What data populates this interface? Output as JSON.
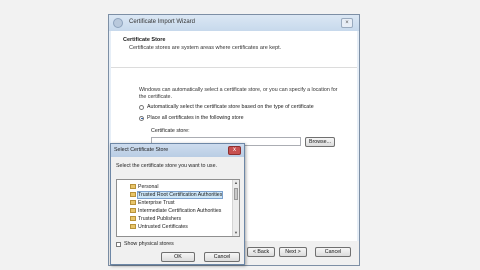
{
  "wizard": {
    "title": "Certificate Import Wizard",
    "heading": "Certificate Store",
    "description": "Certificate stores are system areas where certificates are kept.",
    "paragraph": "Windows can automatically select a certificate store, or you can specify a location for the certificate.",
    "radio_auto": "Automatically select the certificate store based on the type of certificate",
    "radio_manual": "Place all certificates in the following store",
    "store_label": "Certificate store:",
    "store_value": "",
    "browse_label": "Browse...",
    "back_label": "< Back",
    "next_label": "Next >",
    "cancel_label": "Cancel"
  },
  "dialog": {
    "title": "Select Certificate Store",
    "close_glyph": "x",
    "instruction": "Select the certificate store you want to use.",
    "items": [
      {
        "label": "Personal"
      },
      {
        "label": "Trusted Root Certification Authorities",
        "selected": true
      },
      {
        "label": "Enterprise Trust"
      },
      {
        "label": "Intermediate Certification Authorities"
      },
      {
        "label": "Trusted Publishers"
      },
      {
        "label": "Untrusted Certificates"
      }
    ],
    "show_physical_label": "Show physical stores",
    "ok_label": "OK",
    "cancel_label": "Cancel"
  },
  "colors": {
    "selection": "#cde6f7",
    "title_gradient": "#c7d9ec",
    "close_button": "#c75050",
    "folder": "#e8c56a"
  }
}
